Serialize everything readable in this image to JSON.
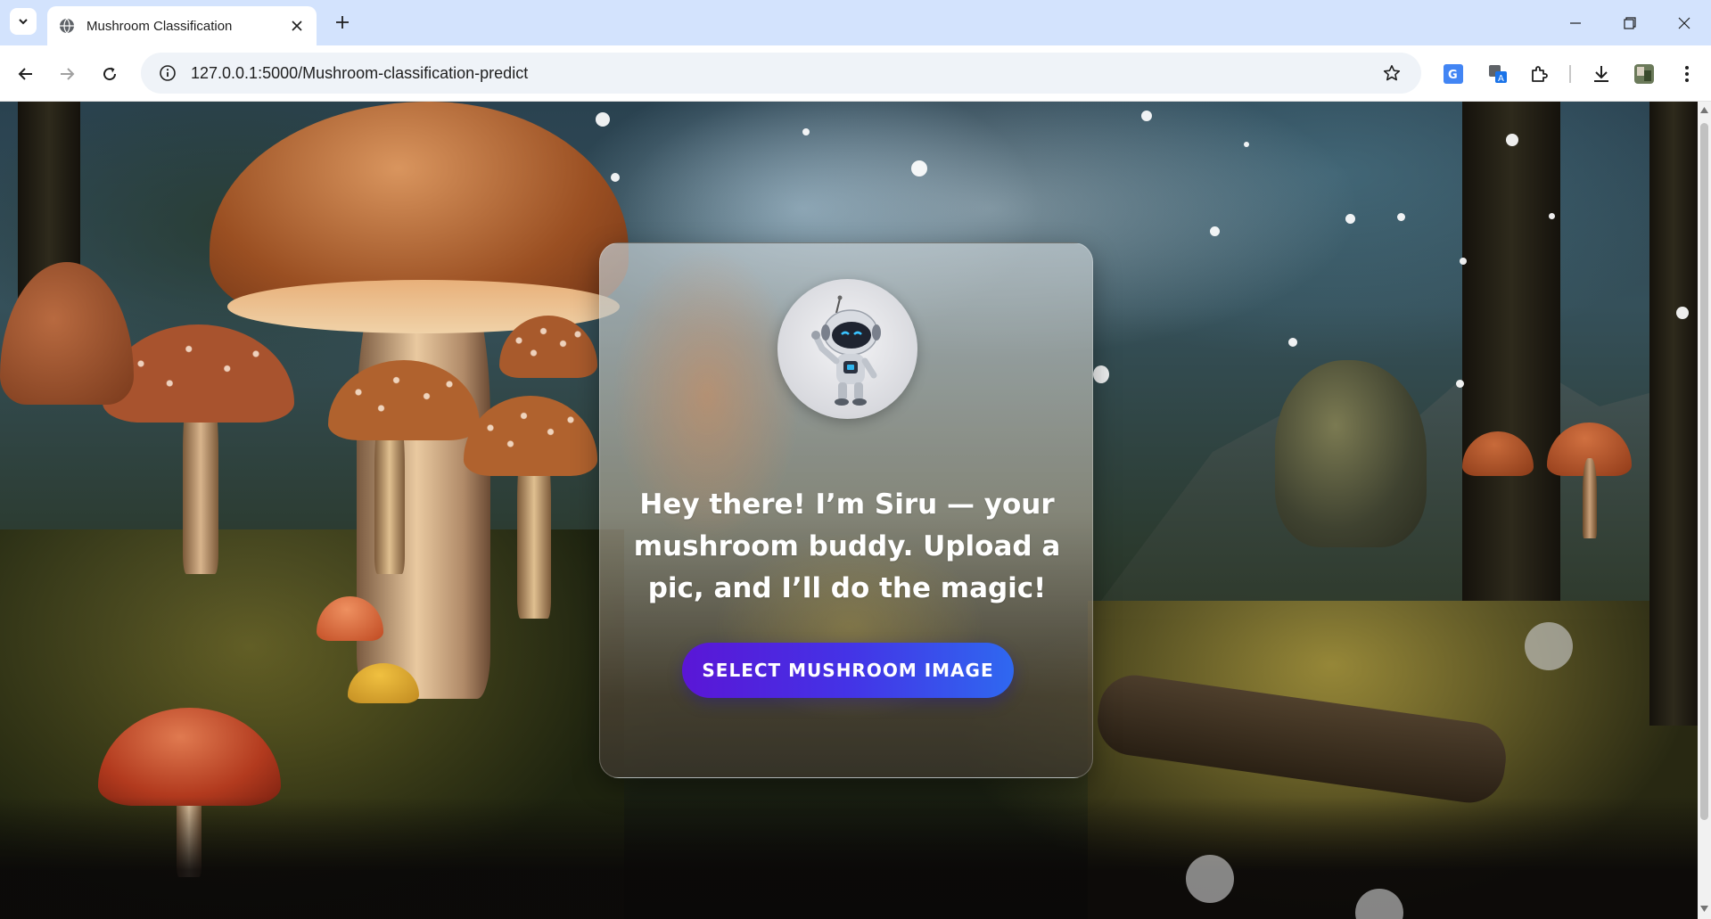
{
  "browser": {
    "tab_title": "Mushroom Classification",
    "url": "127.0.0.1:5000/Mushroom-classification-predict"
  },
  "page": {
    "message": "Hey there! I’m Siru — your mushroom buddy. Upload a pic, and I’ll do the magic!",
    "button_label": "SELECT MUSHROOM IMAGE",
    "accent_start": "#5a16d6",
    "accent_end": "#2f68f0"
  }
}
